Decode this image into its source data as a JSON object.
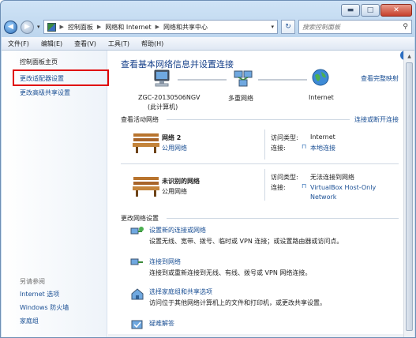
{
  "caption": {
    "minimize": "▬",
    "maximize": "□",
    "close": "✕"
  },
  "navbar": {
    "back": "◀",
    "forward": "▶",
    "history": "▾",
    "breadcrumb": [
      "控制面板",
      "网络和 Internet",
      "网络和共享中心"
    ],
    "search_placeholder": "搜索控制面板"
  },
  "menu": [
    "文件(F)",
    "编辑(E)",
    "查看(V)",
    "工具(T)",
    "帮助(H)"
  ],
  "sidebar": {
    "home": "控制面板主页",
    "items": [
      "更改适配器设置",
      "更改高级共享设置"
    ],
    "see_also_title": "另请参阅",
    "see_also": [
      "Internet 选项",
      "Windows 防火墙",
      "家庭组"
    ]
  },
  "main": {
    "title": "查看基本网络信息并设置连接",
    "view_full_map": "查看完整映射",
    "map": {
      "computer": "ZGC-20130506NGV",
      "computer_sub": "(此计算机)",
      "network": "多重网络",
      "internet": "Internet"
    },
    "active_header": "查看活动网络",
    "connect_disconnect": "连接或断开连接",
    "networks": [
      {
        "name": "网络  2",
        "type": "公用网络",
        "access_label": "访问类型:",
        "access_value": "Internet",
        "conn_label": "连接:",
        "conn_value": "本地连接"
      },
      {
        "name": "未识别的网络",
        "type": "公用网络",
        "access_label": "访问类型:",
        "access_value": "无法连接到网络",
        "conn_label": "连接:",
        "conn_value": "VirtualBox Host-Only Network"
      }
    ],
    "change_header": "更改网络设置",
    "tasks": [
      {
        "title": "设置新的连接或网络",
        "desc": "设置无线、宽带、拨号、临时或 VPN 连接；或设置路由器或访问点。"
      },
      {
        "title": "连接到网络",
        "desc": "连接到或重新连接到无线、有线、拨号或 VPN 网络连接。"
      },
      {
        "title": "选择家庭组和共享选项",
        "desc": "访问位于其他网络计算机上的文件和打印机，或更改共享设置。"
      },
      {
        "title": "疑难解答",
        "desc": ""
      }
    ]
  },
  "colors": {
    "link": "#1a4f94",
    "title": "#16408a",
    "highlight_box": "#e00000"
  }
}
